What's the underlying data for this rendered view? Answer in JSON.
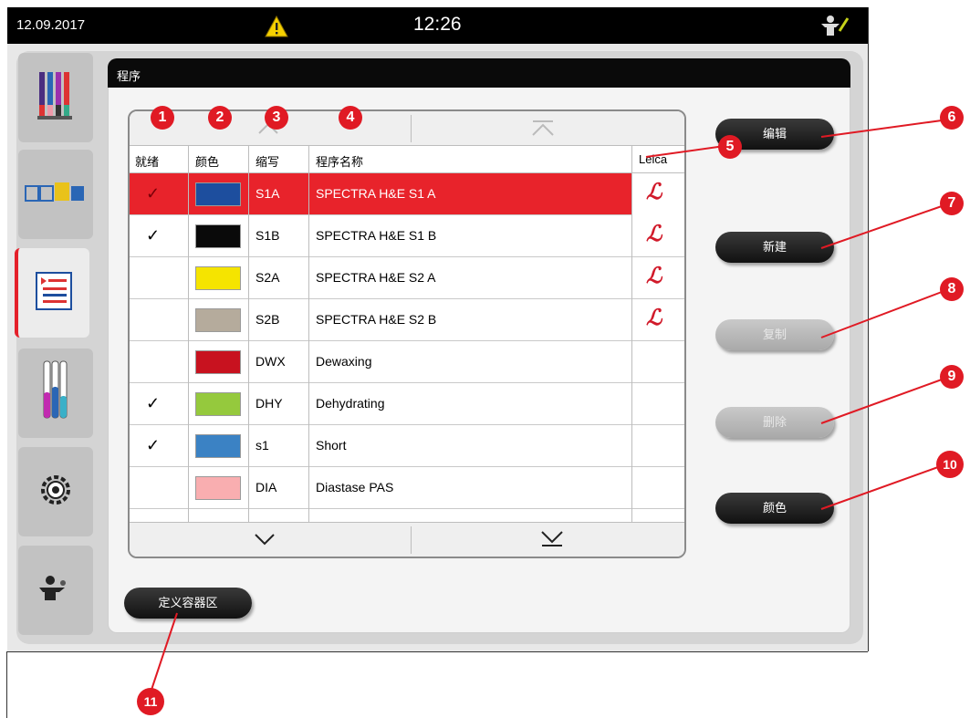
{
  "status_bar": {
    "date": "12.09.2017",
    "time": "12:26"
  },
  "panel": {
    "title": "程序"
  },
  "table": {
    "headers": {
      "ready": "就绪",
      "color": "颜色",
      "abbr": "缩写",
      "name": "程序名称",
      "leica": "Leica"
    },
    "rows": [
      {
        "ready": "✓",
        "color": "#1d4e9e",
        "abbr": "S1A",
        "name": "SPECTRA H&E S1 A",
        "leica": "ℒ",
        "selected": true
      },
      {
        "ready": "✓",
        "color": "#0a0a0a",
        "abbr": "S1B",
        "name": "SPECTRA H&E S1 B",
        "leica": "ℒ",
        "selected": false
      },
      {
        "ready": "",
        "color": "#f5e400",
        "abbr": "S2A",
        "name": "SPECTRA H&E S2 A",
        "leica": "ℒ",
        "selected": false
      },
      {
        "ready": "",
        "color": "#b5ab9c",
        "abbr": "S2B",
        "name": "SPECTRA H&E S2 B",
        "leica": "ℒ",
        "selected": false
      },
      {
        "ready": "",
        "color": "#c8121f",
        "abbr": "DWX",
        "name": "Dewaxing",
        "leica": "",
        "selected": false
      },
      {
        "ready": "✓",
        "color": "#95c93d",
        "abbr": "DHY",
        "name": "Dehydrating",
        "leica": "",
        "selected": false
      },
      {
        "ready": "✓",
        "color": "#3b82c4",
        "abbr": "s1",
        "name": "Short",
        "leica": "",
        "selected": false
      },
      {
        "ready": "",
        "color": "#f9aeb0",
        "abbr": "DIA",
        "name": "Diastase PAS",
        "leica": "",
        "selected": false
      }
    ]
  },
  "buttons": {
    "edit": "编辑",
    "new": "新建",
    "copy": "复制",
    "delete": "删除",
    "color": "颜色",
    "define": "定义容器区"
  },
  "callouts": [
    "1",
    "2",
    "3",
    "4",
    "5",
    "6",
    "7",
    "8",
    "9",
    "10",
    "11"
  ],
  "icons": [
    "warning-icon",
    "user-icon",
    "reagent-rack-icon",
    "bath-layout-icon",
    "program-list-icon",
    "reagents-icon",
    "settings-icon",
    "user-settings-icon",
    "chevron-up-icon",
    "double-chevron-up-icon",
    "chevron-down-icon",
    "double-chevron-down-icon"
  ]
}
